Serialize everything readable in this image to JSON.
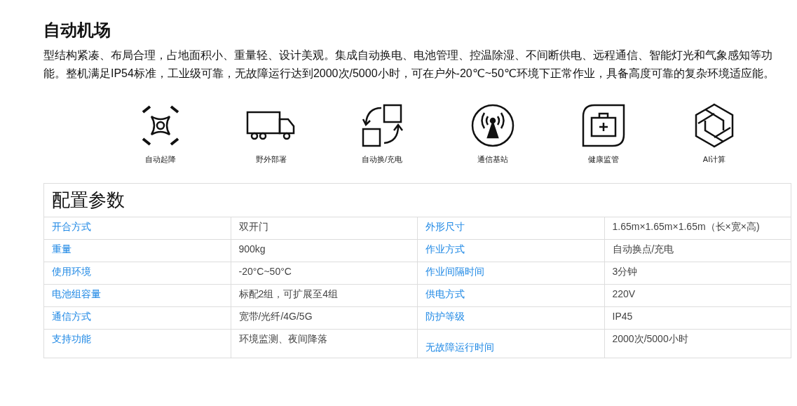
{
  "title": "自动机场",
  "description": "型结构紧凑、布局合理，占地面积小、重量轻、设计美观。集成自动换电、电池管理、控温除湿、不间断供电、远程通信、智能灯光和气象感知等功能。整机满足IP54标准，工业级可靠，无故障运行达到2000次/5000小时，可在户外-20℃~50℃环境下正常作业，具备高度可靠的复杂环境适应能。",
  "features": [
    {
      "kind": "drone",
      "label": "自动起降"
    },
    {
      "kind": "truck",
      "label": "野外部署"
    },
    {
      "kind": "swap",
      "label": "自动换/充电"
    },
    {
      "kind": "signal",
      "label": "通信基站"
    },
    {
      "kind": "medkit",
      "label": "健康监管"
    },
    {
      "kind": "ai",
      "label": "AI计算"
    }
  ],
  "specs": {
    "title": "配置参数",
    "rows": [
      [
        "开合方式",
        "双开门",
        "外形尺寸",
        "1.65m×1.65m×1.65m（长×宽×高)"
      ],
      [
        "重量",
        "900kg",
        "作业方式",
        "自动换点/充电"
      ],
      [
        "使用环境",
        "-20°C~50°C",
        "作业间隔时间",
        "3分钟"
      ],
      [
        "电池组容量",
        "标配2组，可扩展至4组",
        "供电方式",
        "220V"
      ],
      [
        "通信方式",
        "宽带/光纤/4G/5G",
        "防护等级",
        "IP45"
      ],
      [
        "支持功能",
        "环境监测、夜间降落",
        "无故障运行时间",
        "2000次/5000小时"
      ]
    ]
  }
}
